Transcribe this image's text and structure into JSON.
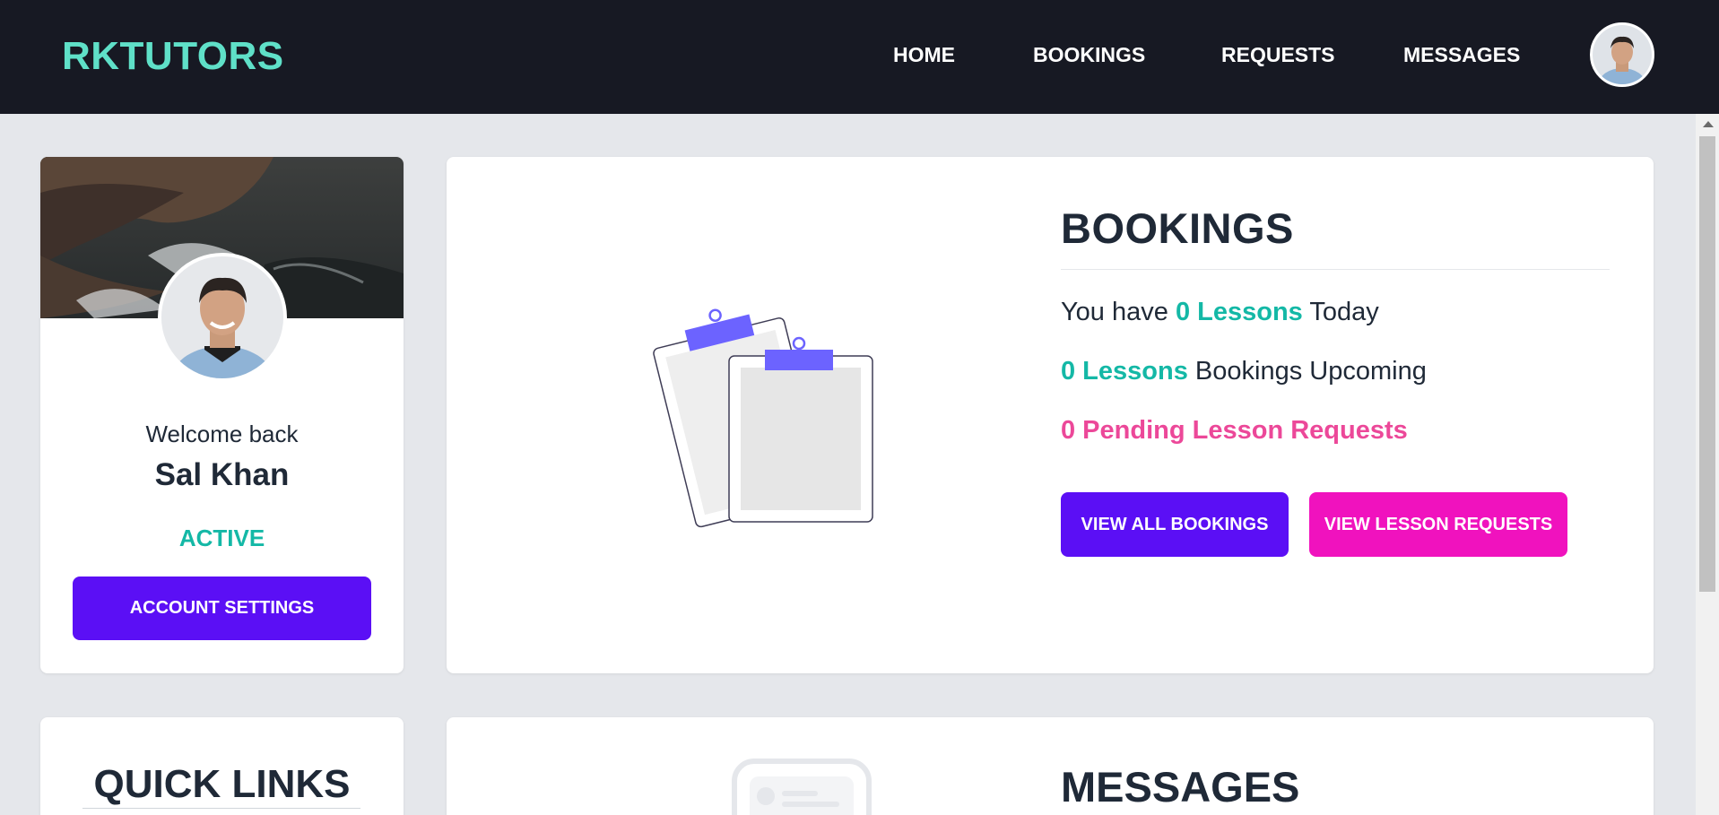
{
  "nav": {
    "brand": "RKTUTORS",
    "links": [
      "HOME",
      "BOOKINGS",
      "REQUESTS",
      "MESSAGES"
    ]
  },
  "profile": {
    "welcome": "Welcome back",
    "name": "Sal Khan",
    "status": "ACTIVE",
    "settings_button": "ACCOUNT SETTINGS"
  },
  "bookings": {
    "title": "BOOKINGS",
    "today_prefix": "You have",
    "today_count": "0 Lessons",
    "today_suffix": "Today",
    "upcoming_count": "0 Lessons",
    "upcoming_suffix": "Bookings Upcoming",
    "pending": "0 Pending Lesson Requests",
    "view_all_button": "VIEW ALL BOOKINGS",
    "view_requests_button": "VIEW LESSON REQUESTS"
  },
  "quick_links": {
    "title": "QUICK LINKS"
  },
  "messages": {
    "title": "MESSAGES"
  },
  "colors": {
    "navbar": "#171923",
    "brand": "#5fe0c8",
    "primary": "#5b0ff5",
    "pink_button": "#f012be",
    "teal": "#14b8a6",
    "pink_text": "#ec4899",
    "illustration": "#6c63ff"
  }
}
